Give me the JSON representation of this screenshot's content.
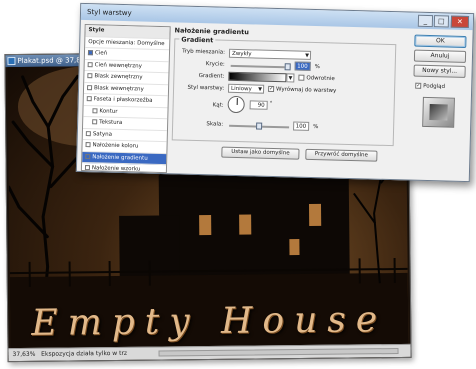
{
  "document": {
    "title": "Plakat.psd @ 37,8% (E",
    "zoom": "37,63%",
    "status_text": "Ekspozycja działa tylko w trz",
    "headline": "Empty House"
  },
  "dialog": {
    "title": "Styl warstwy",
    "style_list": [
      {
        "label": "Style",
        "type": "header"
      },
      {
        "label": "Opcje mieszania: Domyślne",
        "type": "plain"
      },
      {
        "label": "Cień",
        "type": "check",
        "checked": true
      },
      {
        "label": "Cień wewnętrzny",
        "type": "check",
        "checked": false
      },
      {
        "label": "Blask zewnętrzny",
        "type": "check",
        "checked": false
      },
      {
        "label": "Blask wewnętrzny",
        "type": "check",
        "checked": false
      },
      {
        "label": "Faseta i płaskorzeźba",
        "type": "check",
        "checked": false
      },
      {
        "label": "Kontur",
        "type": "sub",
        "checked": false
      },
      {
        "label": "Tekstura",
        "type": "sub",
        "checked": false
      },
      {
        "label": "Satyna",
        "type": "check",
        "checked": false
      },
      {
        "label": "Nałożenie koloru",
        "type": "check",
        "checked": false
      },
      {
        "label": "Nałożenie gradientu",
        "type": "check",
        "checked": true,
        "selected": true
      },
      {
        "label": "Nałożenie wzorku",
        "type": "check",
        "checked": false
      },
      {
        "label": "Obrys",
        "type": "check",
        "checked": false
      }
    ],
    "section_title": "Nałożenie gradientu",
    "group_title": "Gradient",
    "blend_mode_label": "Tryb mieszania:",
    "blend_mode_value": "Zwykły",
    "opacity_label": "Krycie:",
    "opacity_value": "100",
    "opacity_unit": "%",
    "opacity_fraction": 1.0,
    "gradient_label": "Gradient:",
    "reverse_label": "Odwrotnie",
    "reverse_checked": false,
    "style_label": "Styl warstwy:",
    "style_value": "Liniowy",
    "align_label": "Wyrównaj do warstwy",
    "align_checked": true,
    "angle_label": "Kąt:",
    "angle_value": "90",
    "angle_unit": "°",
    "scale_label": "Skala:",
    "scale_value": "100",
    "scale_unit": "%",
    "scale_fraction": 0.5,
    "default_button": "Ustaw jako domyślne",
    "reset_button": "Przywróć domyślne",
    "ok_button": "OK",
    "cancel_button": "Anuluj",
    "new_style_button": "Nowy styl...",
    "preview_label": "Podgląd",
    "preview_checked": true
  }
}
